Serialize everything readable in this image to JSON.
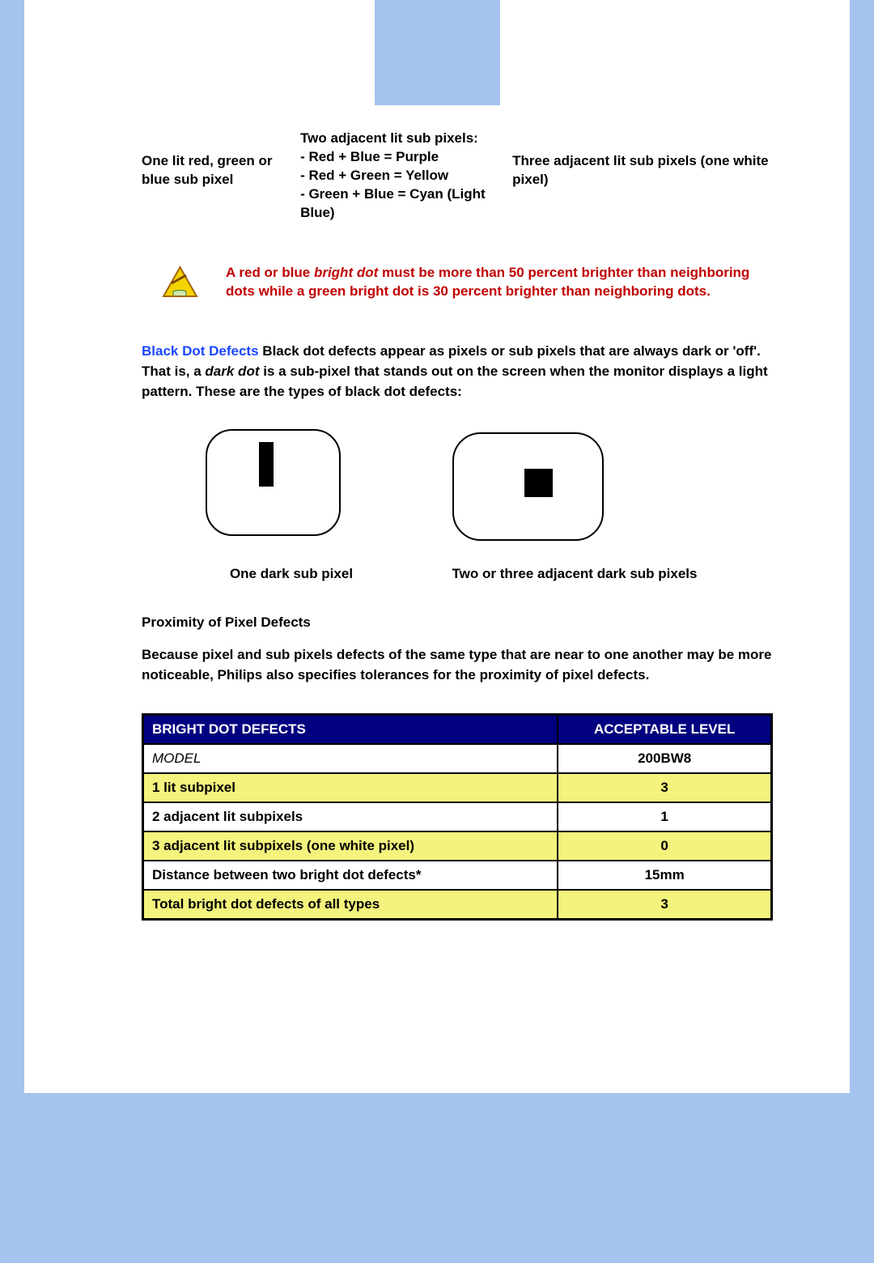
{
  "captions": {
    "one_lit": "One lit red, green or blue sub pixel",
    "two_adj_title": "Two adjacent lit sub pixels:",
    "two_adj_l1": "- Red + Blue = Purple",
    "two_adj_l2": "- Red + Green = Yellow",
    "two_adj_l3": "- Green + Blue = Cyan (Light Blue)",
    "three_adj": "Three adjacent lit sub pixels (one white pixel)"
  },
  "note": {
    "part1": "A red or blue ",
    "em": "bright dot",
    "part2": " must be more than 50 percent brighter than neighboring dots while a green bright dot is 30 percent brighter than neighboring dots."
  },
  "black_dot": {
    "label": "Black Dot Defects",
    "text1": " Black dot defects appear as pixels or sub pixels that are always dark or 'off'. That is, a ",
    "em": "dark dot",
    "text2": " is a sub-pixel that stands out on the screen when the monitor displays a light pattern. These are the types of black dot defects:"
  },
  "dark_captions": {
    "one": "One dark sub pixel",
    "multi": "Two or three adjacent dark sub pixels"
  },
  "proximity": {
    "title": "Proximity of Pixel Defects",
    "text": "Because pixel and sub pixels defects of the same type that are near to one another may be more noticeable, Philips also specifies tolerances for the proximity of pixel defects."
  },
  "table": {
    "h1": "BRIGHT DOT DEFECTS",
    "h2": "ACCEPTABLE LEVEL",
    "rows": [
      {
        "label": "MODEL",
        "value": "200BW8",
        "cls": "model"
      },
      {
        "label": "1 lit subpixel",
        "value": "3",
        "cls": "yellow"
      },
      {
        "label": "2 adjacent lit subpixels",
        "value": "1",
        "cls": ""
      },
      {
        "label": "3 adjacent lit subpixels (one white pixel)",
        "value": "0",
        "cls": "yellow"
      },
      {
        "label": "Distance between two bright dot defects*",
        "value": "15mm",
        "cls": ""
      },
      {
        "label": "Total bright dot defects of all types",
        "value": "3",
        "cls": "yellow"
      }
    ]
  }
}
